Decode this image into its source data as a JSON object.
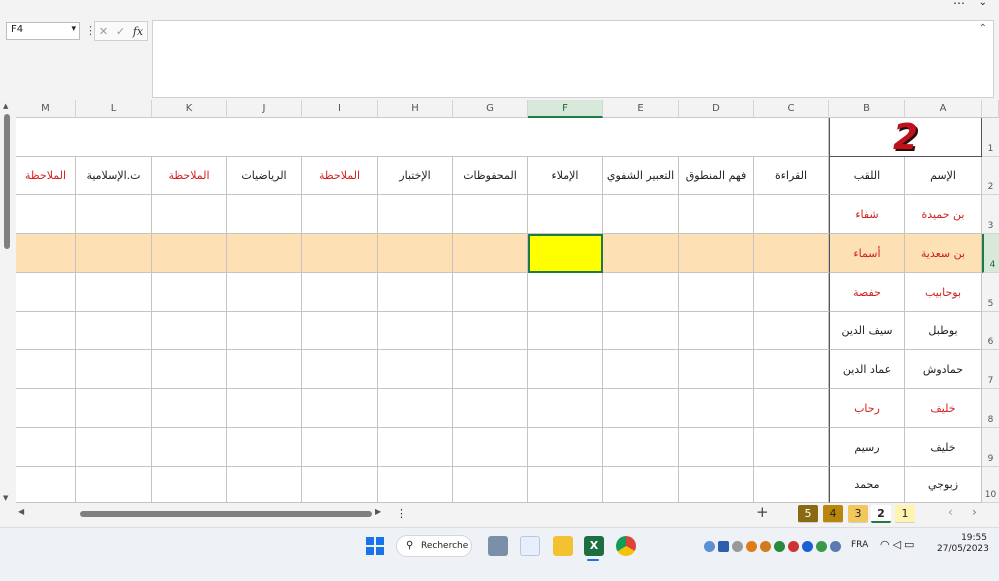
{
  "formula_bar": {
    "name_box": "F4",
    "fx_label": "fx",
    "formula": ""
  },
  "columns": [
    {
      "id": "M",
      "header": "الملاحظة",
      "red": true
    },
    {
      "id": "L",
      "header": "ت.الإسلامية",
      "red": false
    },
    {
      "id": "K",
      "header": "الملاحظة",
      "red": true
    },
    {
      "id": "J",
      "header": "الرياضيات",
      "red": false
    },
    {
      "id": "I",
      "header": "الملاحظة",
      "red": true
    },
    {
      "id": "H",
      "header": "الإختبار",
      "red": false
    },
    {
      "id": "G",
      "header": "المحفوظات",
      "red": false
    },
    {
      "id": "F",
      "header": "الإملاء",
      "red": false
    },
    {
      "id": "E",
      "header": "التعبير الشفوي",
      "red": false
    },
    {
      "id": "D",
      "header": "فهم المنطوق",
      "red": false
    },
    {
      "id": "C",
      "header": "القراءة",
      "red": false
    },
    {
      "id": "B",
      "header": "اللقب",
      "red": false
    },
    {
      "id": "A",
      "header": "الإسم",
      "red": false
    }
  ],
  "row_numbers": [
    "1",
    "2",
    "3",
    "4",
    "5",
    "6",
    "7",
    "8",
    "9",
    "10"
  ],
  "title_cell": "2",
  "students": [
    {
      "row": "3",
      "a": "بن حميدة",
      "b": "شفاء",
      "red": true
    },
    {
      "row": "4",
      "a": "بن سعدية",
      "b": "أسماء",
      "red": true
    },
    {
      "row": "5",
      "a": "بوحابيب",
      "b": "حفصة",
      "red": true
    },
    {
      "row": "6",
      "a": "بوطبل",
      "b": "سيف الدين",
      "red": false
    },
    {
      "row": "7",
      "a": "حمادوش",
      "b": "عماد الدين",
      "red": false
    },
    {
      "row": "8",
      "a": "خليف",
      "b": "رحاب",
      "red": true
    },
    {
      "row": "9",
      "a": "خليف",
      "b": "رسيم",
      "red": false
    },
    {
      "row": "10",
      "a": "زبوجي",
      "b": "محمد",
      "red": false
    }
  ],
  "selected_cell": "F4",
  "sheet_tabs": [
    {
      "label": "5",
      "color": "#8a6a10",
      "text": "#ffffff"
    },
    {
      "label": "4",
      "color": "#b8860b",
      "text": "#222222"
    },
    {
      "label": "3",
      "color": "#f2c75c",
      "text": "#222222"
    },
    {
      "label": "2",
      "color": "#ffffff",
      "text": "#222222",
      "active": true
    },
    {
      "label": "1",
      "color": "#fff3b0",
      "text": "#222222"
    }
  ],
  "taskbar": {
    "search_label": "Recherche",
    "language": "FRA",
    "time": "19:55",
    "date": "27/05/2023"
  },
  "colors": {
    "accent_green": "#1f7a45",
    "highlight_row": "#fde1b4",
    "selected_cell": "#ffff00",
    "red_text": "#d21f1f"
  }
}
